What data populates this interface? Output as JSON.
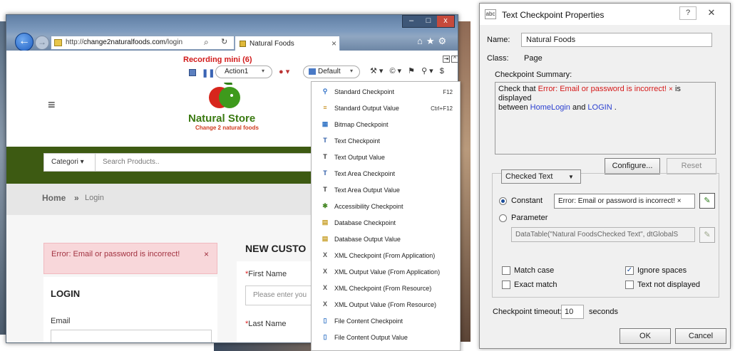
{
  "browser": {
    "url_prefix": "http://",
    "url_domain": "change2naturalfoods.com",
    "url_path": "/login",
    "tab_title": "Natural Foods",
    "tab_close": "×",
    "window_controls": [
      "–",
      "□",
      "x"
    ]
  },
  "page": {
    "brand_name": "Natural Store",
    "brand_tagline": "Change 2 natural foods",
    "search_category": "Categori",
    "search_placeholder": "Search Products..",
    "breadcrumb_home": "Home",
    "breadcrumb_sep": "»",
    "breadcrumb_current": "Login",
    "error_message": "Error: Email or password is incorrect!",
    "error_close": "×",
    "login_title": "LOGIN",
    "email_label": "Email",
    "new_customer_title": "NEW CUSTO",
    "first_name_label": "First Name",
    "first_name_placeholder": "Please enter you",
    "last_name_label": "Last Name",
    "required_mark": "*"
  },
  "recording_bar": {
    "title": "Recording mini (6)",
    "action_select": "Action1",
    "environment_select": "Default"
  },
  "checkpoint_menu": {
    "items": [
      {
        "label": "Standard Checkpoint",
        "shortcut": "F12",
        "icon": "standard-checkpoint-icon",
        "glyph": "⚲",
        "color": "#2d6fc7"
      },
      {
        "label": "Standard Output Value",
        "shortcut": "Ctrl+F12",
        "icon": "standard-output-value-icon",
        "glyph": "≡",
        "color": "#c38a14"
      },
      {
        "label": "Bitmap Checkpoint",
        "shortcut": "",
        "icon": "bitmap-checkpoint-icon",
        "glyph": "▦",
        "color": "#3a7ac8"
      },
      {
        "label": "Text Checkpoint",
        "shortcut": "",
        "icon": "text-checkpoint-icon",
        "glyph": "T",
        "color": "#2a59a6"
      },
      {
        "label": "Text Output Value",
        "shortcut": "",
        "icon": "text-output-value-icon",
        "glyph": "T",
        "color": "#333333"
      },
      {
        "label": "Text Area Checkpoint",
        "shortcut": "",
        "icon": "text-area-checkpoint-icon",
        "glyph": "T",
        "color": "#2a59a6"
      },
      {
        "label": "Text Area Output Value",
        "shortcut": "",
        "icon": "text-area-output-value-icon",
        "glyph": "T",
        "color": "#333333"
      },
      {
        "label": "Accessibility Checkpoint",
        "shortcut": "",
        "icon": "accessibility-checkpoint-icon",
        "glyph": "✱",
        "color": "#4a8a2a"
      },
      {
        "label": "Database Checkpoint",
        "shortcut": "",
        "icon": "database-checkpoint-icon",
        "glyph": "▤",
        "color": "#c8a02a"
      },
      {
        "label": "Database Output Value",
        "shortcut": "",
        "icon": "database-output-value-icon",
        "glyph": "▤",
        "color": "#c8a02a"
      },
      {
        "label": "XML Checkpoint (From Application)",
        "shortcut": "",
        "icon": "xml-checkpoint-app-icon",
        "glyph": "X",
        "color": "#555555"
      },
      {
        "label": "XML Output Value (From Application)",
        "shortcut": "",
        "icon": "xml-output-value-app-icon",
        "glyph": "X",
        "color": "#555555"
      },
      {
        "label": "XML Checkpoint (From Resource)",
        "shortcut": "",
        "icon": "xml-checkpoint-resource-icon",
        "glyph": "X",
        "color": "#555555"
      },
      {
        "label": "XML Output Value (From Resource)",
        "shortcut": "",
        "icon": "xml-output-value-resource-icon",
        "glyph": "X",
        "color": "#555555"
      },
      {
        "label": "File Content Checkpoint",
        "shortcut": "",
        "icon": "file-content-checkpoint-icon",
        "glyph": "▯",
        "color": "#3a7ac8"
      },
      {
        "label": "File Content Output Value",
        "shortcut": "",
        "icon": "file-content-output-value-icon",
        "glyph": "▯",
        "color": "#3a7ac8"
      }
    ]
  },
  "dialog": {
    "title": "Text Checkpoint Properties",
    "help": "?",
    "close": "✕",
    "name_label": "Name:",
    "name_value": "Natural Foods",
    "class_label": "Class:",
    "class_value": "Page",
    "summary_label": "Checkpoint Summary:",
    "summary": {
      "check_that": "Check that",
      "text": "Error: Email or password is incorrect!",
      "remove": "×",
      "is_displayed": "is displayed",
      "between": "between",
      "left_text": "HomeLogin",
      "and": "and",
      "right_text": "LOGIN",
      "end": "."
    },
    "configure_button": "Configure...",
    "reset_button": "Reset",
    "text_type_select": "Checked Text",
    "constant_label": "Constant",
    "constant_value": "Error: Email or password is incorrect! ×",
    "parameter_label": "Parameter",
    "parameter_value": "DataTable(\"Natural FoodsChecked Text\", dtGlobalS",
    "match_case_label": "Match case",
    "match_case": false,
    "ignore_spaces_label": "Ignore spaces",
    "ignore_spaces": true,
    "exact_match_label": "Exact match",
    "exact_match": false,
    "text_not_displayed_label": "Text not displayed",
    "text_not_displayed": false,
    "timeout_label": "Checkpoint timeout:",
    "timeout_value": "10",
    "timeout_unit": "seconds",
    "ok_button": "OK",
    "cancel_button": "Cancel"
  },
  "colors": {
    "error_red": "#d51818",
    "link_blue": "#2a3fd0",
    "brand_green": "#3b7a12",
    "nav_green": "#3d5a12",
    "recording_red": "#d11a1a"
  }
}
